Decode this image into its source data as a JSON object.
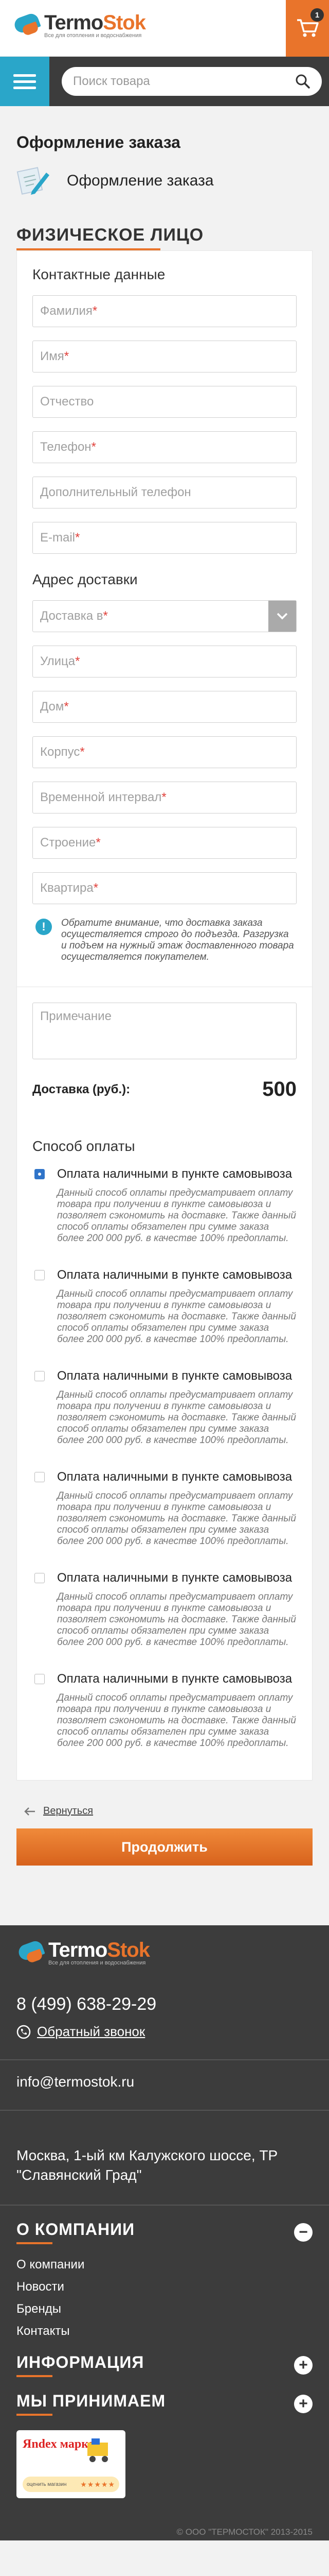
{
  "header": {
    "logo_part1": "Termo",
    "logo_part2": "Stok",
    "tagline": "Все для отопления и водоснабжения",
    "cart_count": "1"
  },
  "search": {
    "placeholder": "Поиск товара"
  },
  "page": {
    "title": "Оформление заказа",
    "breadcrumb": "Оформление заказа"
  },
  "form": {
    "section_title": "ФИЗИЧЕСКОЕ ЛИЦО",
    "contact_title": "Контактные данные",
    "contact_fields": [
      {
        "label": "Фамилия",
        "required": "*"
      },
      {
        "label": "Имя",
        "required": "*"
      },
      {
        "label": "Отчество",
        "required": ""
      },
      {
        "label": "Телефон",
        "required": "*"
      },
      {
        "label": "Дополнительный телефон",
        "required": ""
      },
      {
        "label": "E-mail",
        "required": "*"
      }
    ],
    "address_title": "Адрес доставки",
    "delivery_select": {
      "label": "Доставка в",
      "required": "*"
    },
    "address_fields": [
      {
        "label": "Улица",
        "required": "*"
      },
      {
        "label": "Дом",
        "required": "*"
      },
      {
        "label": "Корпус",
        "required": "*"
      },
      {
        "label": "Временной интервал",
        "required": "*"
      },
      {
        "label": "Строение",
        "required": "*"
      },
      {
        "label": "Квартира",
        "required": "*"
      }
    ],
    "notice": "Обратите внимание, что доставка заказа осуществляется строго до подъезда. Разгрузка и подъем на нужный этаж доставленного товара осуществляется покупателем.",
    "comment_placeholder": "Примечание",
    "delivery_label": "Доставка (руб.):",
    "delivery_value": "500",
    "payment_title": "Способ оплаты",
    "payment_options": [
      {
        "title": "Оплата наличными в пункте самовывоза",
        "checked": true
      },
      {
        "title": "Оплата наличными в пункте самовывоза",
        "checked": false
      },
      {
        "title": "Оплата наличными в пункте самовывоза",
        "checked": false
      },
      {
        "title": "Оплата наличными в пункте самовывоза",
        "checked": false
      },
      {
        "title": "Оплата наличными в пункте самовывоза",
        "checked": false
      },
      {
        "title": "Оплата наличными в пункте самовывоза",
        "checked": false
      }
    ],
    "payment_desc": "Данный способ оплаты предусматривает оплату товара при получении в пункте самовывоза и позволяет сэкономить на доставке. Также данный способ оплаты обязателен при сумме заказа более 200 000 руб. в качестве 100% предоплаты."
  },
  "actions": {
    "back_label": "Вернуться",
    "continue_label": "Продолжить"
  },
  "footer": {
    "phone": "8 (499) 638-29-29",
    "callback": "Обратный звонок",
    "email": "info@termostok.ru",
    "address": "Москва, 1-ый км Калужского шоссе, ТР \"Славянский Град\"",
    "company_title": "О КОМПАНИИ",
    "company_links": [
      "О компании",
      "Новости",
      "Бренды",
      "Контакты"
    ],
    "info_title": "ИНФОРМАЦИЯ",
    "accept_title": "МЫ ПРИНИМАЕМ",
    "market_logo": "Яndex маркет",
    "market_caption": "оценить магазин",
    "copyright": "© ООО \"ТЕРМОСТОК\" 2013-2015"
  },
  "colors": {
    "accent": "#e9742b",
    "blue": "#2aa6c9",
    "dark": "#3c3c3c"
  }
}
